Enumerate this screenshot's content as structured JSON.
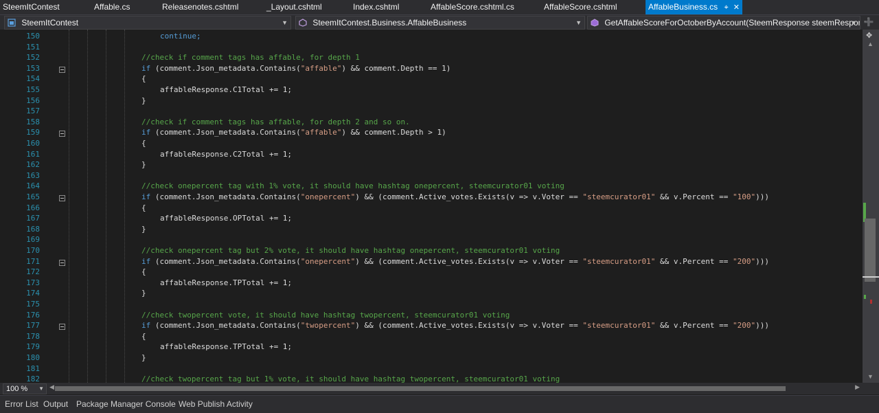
{
  "tabs": [
    {
      "label": "SteemItContest"
    },
    {
      "label": "Affable.cs"
    },
    {
      "label": "Releasenotes.cshtml"
    },
    {
      "label": "_Layout.cshtml"
    },
    {
      "label": "Index.cshtml"
    },
    {
      "label": "AffableScore.cshtml.cs"
    },
    {
      "label": "AffableScore.cshtml"
    },
    {
      "label": "AffableBusiness.cs",
      "active": true
    }
  ],
  "nav": {
    "project": "SteemItContest",
    "class": "SteemItContest.Business.AffableBusiness",
    "member": "GetAffableScoreForOctoberByAccount(SteemResponse steemResponse)"
  },
  "editor": {
    "line_numbers": [
      "150",
      "151",
      "152",
      "153",
      "154",
      "155",
      "156",
      "157",
      "158",
      "159",
      "160",
      "161",
      "162",
      "163",
      "164",
      "165",
      "166",
      "167",
      "168",
      "169",
      "170",
      "171",
      "172",
      "173",
      "174",
      "175",
      "176",
      "177",
      "178",
      "179",
      "180",
      "181",
      "182"
    ],
    "lines": {
      "l150": "continue;",
      "l152": "//check if comment tags has affable, for depth 1",
      "l153a": "if",
      "l153b": " (comment.Json_metadata.Contains(",
      "l153c": "\"affable\"",
      "l153d": ") && comment.Depth == 1)",
      "l154": "{",
      "l155": "affableResponse.C1Total += 1;",
      "l156": "}",
      "l158": "//check if comment tags has affable, for depth 2 and so on.",
      "l159a": "if",
      "l159b": " (comment.Json_metadata.Contains(",
      "l159c": "\"affable\"",
      "l159d": ") && comment.Depth > 1)",
      "l160": "{",
      "l161": "affableResponse.C2Total += 1;",
      "l162": "}",
      "l164": "//check onepercent tag with 1% vote, it should have hashtag onepercent, steemcurator01 voting",
      "l165a": "if",
      "l165b": " (comment.Json_metadata.Contains(",
      "l165c": "\"onepercent\"",
      "l165d": ") && (comment.Active_votes.Exists(v => v.Voter == ",
      "l165e": "\"steemcurator01\"",
      "l165f": " && v.Percent == ",
      "l165g": "\"100\"",
      "l165h": ")))",
      "l166": "{",
      "l167": "affableResponse.OPTotal += 1;",
      "l168": "}",
      "l170": "//check onepercent tag but 2% vote, it should have hashtag onepercent, steemcurator01 voting",
      "l171a": "if",
      "l171b": " (comment.Json_metadata.Contains(",
      "l171c": "\"onepercent\"",
      "l171d": ") && (comment.Active_votes.Exists(v => v.Voter == ",
      "l171e": "\"steemcurator01\"",
      "l171f": " && v.Percent == ",
      "l171g": "\"200\"",
      "l171h": ")))",
      "l172": "{",
      "l173": "affableResponse.TPTotal += 1;",
      "l174": "}",
      "l176": "//check twopercent vote, it should have hashtag twopercent, steemcurator01 voting",
      "l177a": "if",
      "l177b": " (comment.Json_metadata.Contains(",
      "l177c": "\"twopercent\"",
      "l177d": ") && (comment.Active_votes.Exists(v => v.Voter == ",
      "l177e": "\"steemcurator01\"",
      "l177f": " && v.Percent == ",
      "l177g": "\"200\"",
      "l177h": ")))",
      "l178": "{",
      "l179": "affableResponse.TPTotal += 1;",
      "l180": "}",
      "l182": "//check twopercent tag but 1% vote, it should have hashtag twopercent, steemcurator01 voting"
    }
  },
  "zoom": "100 %",
  "tool_windows": [
    "Error List",
    "Output",
    "Package Manager Console",
    "Web Publish Activity"
  ],
  "colors": {
    "accent": "#007acc",
    "keyword": "#569cd6",
    "string": "#d69d85",
    "comment": "#57a64a",
    "line_number": "#2b91af"
  }
}
